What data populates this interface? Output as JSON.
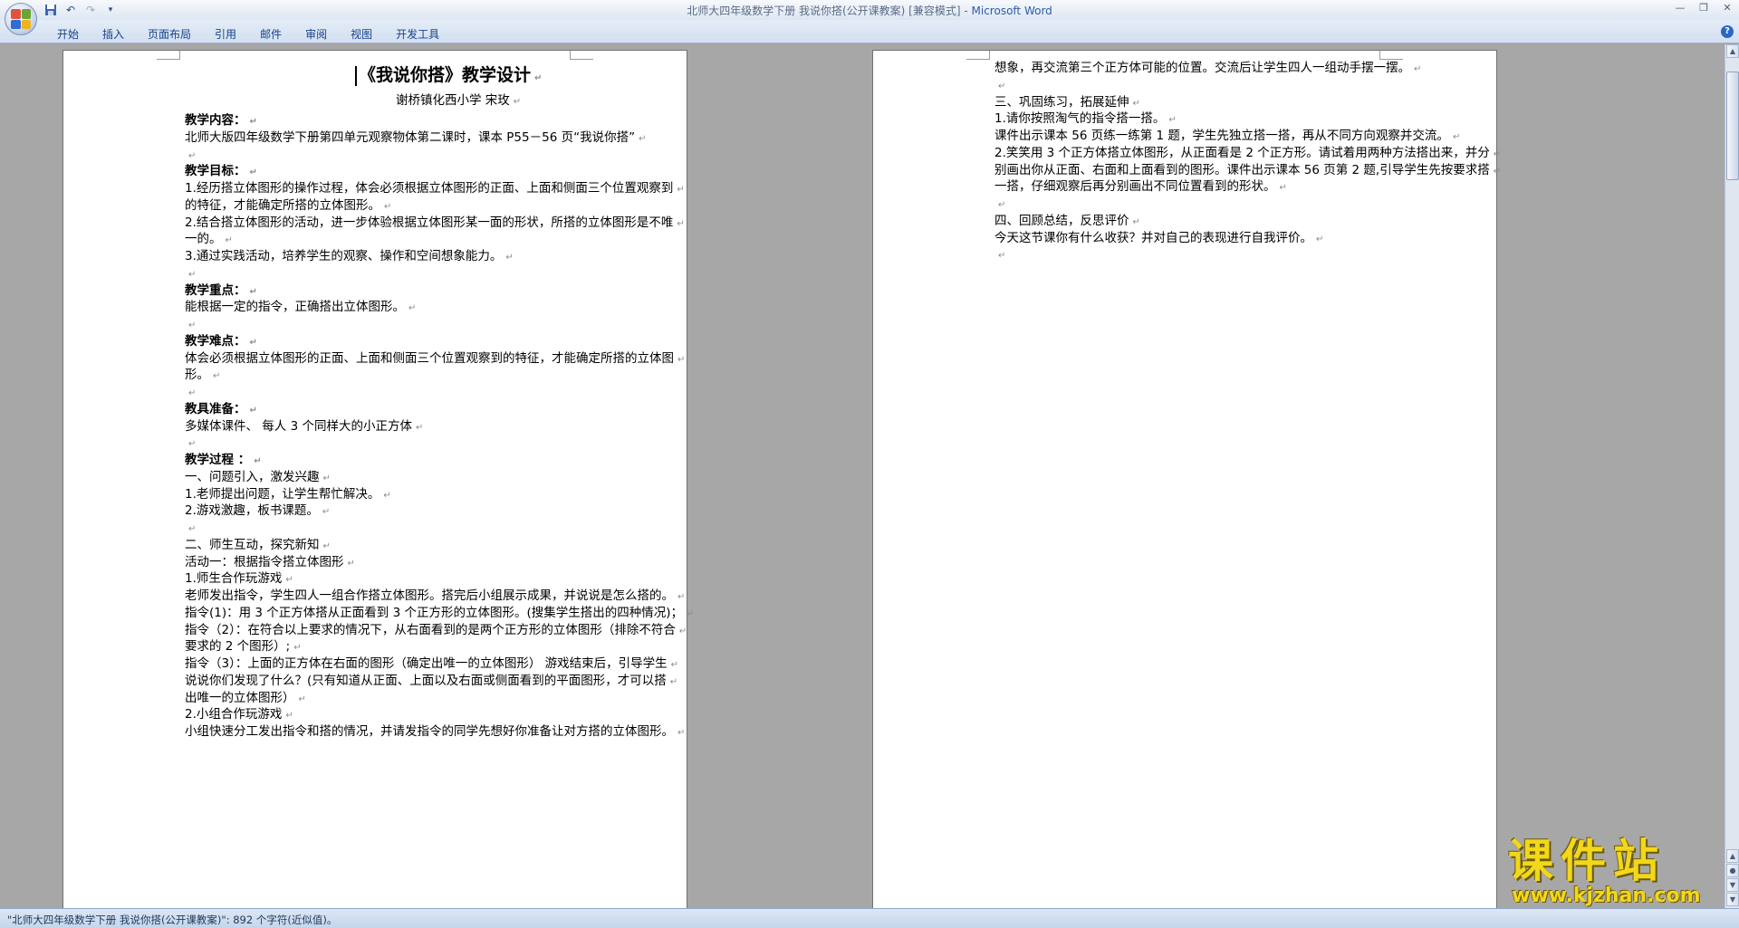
{
  "titlebar": {
    "doc_name": "北师大四年级数学下册  我说你搭(公开课教案) [兼容模式]",
    "separator": " - ",
    "app_name": "Microsoft Word"
  },
  "ribbon": {
    "tabs": [
      "开始",
      "插入",
      "页面布局",
      "引用",
      "邮件",
      "审阅",
      "视图",
      "开发工具"
    ]
  },
  "page1": {
    "title": "《我说你搭》教学设计",
    "author": "谢桥镇化西小学  宋玫",
    "lines": [
      {
        "text": "教学内容：",
        "bold": true
      },
      {
        "text": "北师大版四年级数学下册第四单元观察物体第二课时，课本 P55－56 页“我说你搭”",
        "bold": false
      },
      {
        "text": "",
        "bold": false
      },
      {
        "text": "教学目标：",
        "bold": true
      },
      {
        "text": "1.经历搭立体图形的操作过程，体会必须根据立体图形的正面、上面和侧面三个位置观察到",
        "bold": false
      },
      {
        "text": "的特征，才能确定所搭的立体图形。",
        "bold": false
      },
      {
        "text": "2.结合搭立体图形的活动，进一步体验根据立体图形某一面的形状，所搭的立体图形是不唯",
        "bold": false
      },
      {
        "text": "一的。",
        "bold": false
      },
      {
        "text": "3.通过实践活动，培养学生的观察、操作和空间想象能力。",
        "bold": false
      },
      {
        "text": "",
        "bold": false
      },
      {
        "text": "教学重点：",
        "bold": true
      },
      {
        "text": "能根据一定的指令，正确搭出立体图形。",
        "bold": false
      },
      {
        "text": "",
        "bold": false
      },
      {
        "text": "教学难点：",
        "bold": true
      },
      {
        "text": "体会必须根据立体图形的正面、上面和侧面三个位置观察到的特征，才能确定所搭的立体图",
        "bold": false
      },
      {
        "text": "形。",
        "bold": false
      },
      {
        "text": "",
        "bold": false
      },
      {
        "text": "教具准备：",
        "bold": true
      },
      {
        "text": "多媒体课件、 每人 3 个同样大的小正方体",
        "bold": false
      },
      {
        "text": "",
        "bold": false
      },
      {
        "text": "教学过程  ：",
        "bold": true
      },
      {
        "text": "一、问题引入，激发兴趣",
        "bold": false
      },
      {
        "text": "   1.老师提出问题，让学生帮忙解决。",
        "bold": false
      },
      {
        "text": "   2.游戏激趣，板书课题。",
        "bold": false
      },
      {
        "text": "",
        "bold": false
      },
      {
        "text": "二、师生互动，探究新知",
        "bold": false
      },
      {
        "text": " 活动一：根据指令搭立体图形",
        "bold": false
      },
      {
        "text": "1.师生合作玩游戏",
        "bold": false
      },
      {
        "text": " 老师发出指令，学生四人一组合作搭立体图形。搭完后小组展示成果，并说说是怎么搭的。",
        "bold": false
      },
      {
        "text": "指令(1)：用 3 个正方体搭从正面看到 3 个正方形的立体图形。(搜集学生搭出的四种情况)；",
        "bold": false
      },
      {
        "text": "指令（2）：在符合以上要求的情况下，从右面看到的是两个正方形的立体图形（排除不符合",
        "bold": false
      },
      {
        "text": "要求的 2 个图形）;",
        "bold": false
      },
      {
        "text": "指令（3）：上面的正方体在右面的图形（确定出唯一的立体图形） 游戏结束后，引导学生",
        "bold": false
      },
      {
        "text": "说说你们发现了什么？(只有知道从正面、上面以及右面或侧面看到的平面图形，才可以搭",
        "bold": false
      },
      {
        "text": "出唯一的立体图形）",
        "bold": false
      },
      {
        "text": "2.小组合作玩游戏",
        "bold": false
      },
      {
        "text": "小组快速分工发出指令和搭的情况，并请发指令的同学先想好你准备让对方搭的立体图形。",
        "bold": false
      }
    ]
  },
  "page2": {
    "lines": [
      {
        "text": "想象，再交流第三个正方体可能的位置。交流后让学生四人一组动手摆一摆。"
      },
      {
        "text": ""
      },
      {
        "text": "三、巩固练习，拓展延伸"
      },
      {
        "text": " 1.请你按照淘气的指令搭一搭。"
      },
      {
        "text": " 课件出示课本 56 页练一练第 1 题，学生先独立搭一搭，再从不同方向观察并交流。"
      },
      {
        "text": "2.笑笑用 3 个正方体搭立体图形，从正面看是 2 个正方形。请试着用两种方法搭出来，并分"
      },
      {
        "text": "别画出你从正面、右面和上面看到的图形。课件出示课本 56 页第 2 题,引导学生先按要求搭"
      },
      {
        "text": "一搭，仔细观察后再分别画出不同位置看到的形状。"
      },
      {
        "text": ""
      },
      {
        "text": "四、回顾总结，反思评价"
      },
      {
        "text": " 今天这节课你有什么收获？并对自己的表现进行自我评价。"
      },
      {
        "text": ""
      }
    ]
  },
  "statusbar": {
    "text": "\"北师大四年级数学下册  我说你搭(公开课教案)\": 892 个字符(近似值)。"
  },
  "watermark": {
    "title": "课件站",
    "url": "www.kjzhan.com"
  },
  "colors": {
    "accent": "#2d5ca8",
    "tab_text": "#15428b",
    "watermark": "#f2d71a"
  },
  "icons": {
    "office_button": "office-logo-icon",
    "quick_access": [
      "save-icon",
      "undo-icon",
      "redo-icon",
      "customize-icon"
    ],
    "window": [
      "minimize-icon",
      "maximize-icon",
      "close-icon"
    ],
    "help": "help-icon",
    "paragraph_mark": "↵"
  }
}
